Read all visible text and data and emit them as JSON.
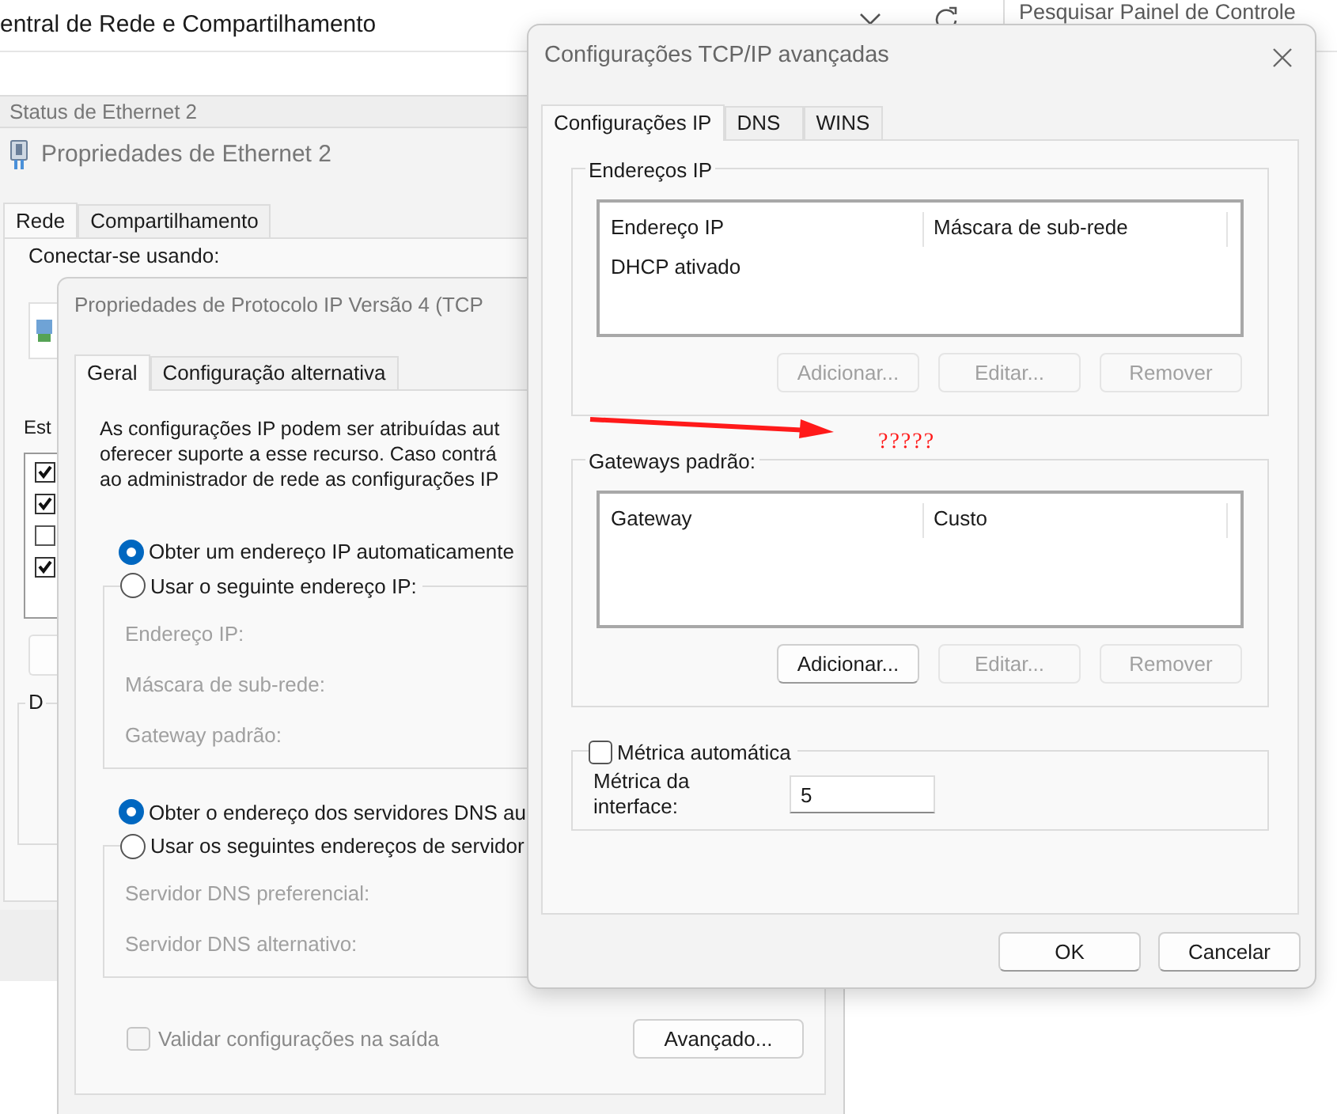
{
  "explorer": {
    "title": "entral de Rede e Compartilhamento",
    "search": {
      "placeholder": "Pesquisar Painel de Controle"
    }
  },
  "status_window": {
    "title": "Status de Ethernet 2"
  },
  "ethernet_window": {
    "title": "Propriedades de Ethernet 2",
    "tabs": [
      {
        "label": "Rede",
        "selected": true
      },
      {
        "label": "Compartilhamento",
        "selected": false
      }
    ],
    "connect_label": "Conectar-se usando:",
    "items_label": "Est",
    "components": [
      {
        "checked": true
      },
      {
        "checked": true
      },
      {
        "checked": false
      },
      {
        "checked": true
      }
    ],
    "group_label": "D"
  },
  "ipv4_window": {
    "title": "Propriedades de Protocolo IP Versão 4 (TCP",
    "tabs": [
      {
        "label": "Geral",
        "selected": true
      },
      {
        "label": "Configuração alternativa",
        "selected": false
      }
    ],
    "intro_lines": [
      "As configurações IP podem ser atribuídas aut",
      "oferecer suporte a esse recurso. Caso contrá",
      "ao administrador de rede as configurações IP"
    ],
    "ip_options": [
      {
        "label": "Obter um endereço IP automaticamente",
        "selected": true
      },
      {
        "label": "Usar o seguinte endereço IP:",
        "selected": false
      }
    ],
    "ip_fields": [
      {
        "label": "Endereço IP:",
        "disabled": true
      },
      {
        "label": "Máscara de sub-rede:",
        "disabled": true
      },
      {
        "label": "Gateway padrão:",
        "disabled": true
      }
    ],
    "dns_options": [
      {
        "label": "Obter o endereço dos servidores DNS au",
        "selected": true
      },
      {
        "label": "Usar os seguintes endereços de servidor",
        "selected": false
      }
    ],
    "dns_fields": [
      {
        "label": "Servidor DNS preferencial:",
        "disabled": true
      },
      {
        "label": "Servidor DNS alternativo:",
        "disabled": true
      }
    ],
    "validate": {
      "label": "Validar configurações na saída",
      "checked": false,
      "disabled": true
    },
    "advanced_button": "Avançado..."
  },
  "advanced_window": {
    "title": "Configurações TCP/IP avançadas",
    "tabs": [
      {
        "label": "Configurações IP",
        "selected": true
      },
      {
        "label": "DNS",
        "selected": false
      },
      {
        "label": "WINS",
        "selected": false
      }
    ],
    "ip_group": {
      "title": "Endereços IP",
      "columns": [
        "Endereço IP",
        "Máscara de sub-rede"
      ],
      "rows": [
        [
          "DHCP ativado"
        ]
      ],
      "buttons": [
        {
          "label": "Adicionar...",
          "disabled": true
        },
        {
          "label": "Editar...",
          "disabled": true
        },
        {
          "label": "Remover",
          "disabled": true
        }
      ]
    },
    "gateway_group": {
      "title": "Gateways padrão:",
      "columns": [
        "Gateway",
        "Custo"
      ],
      "buttons": [
        {
          "label": "Adicionar...",
          "disabled": false
        },
        {
          "label": "Editar...",
          "disabled": true
        },
        {
          "label": "Remover",
          "disabled": true
        }
      ]
    },
    "metric": {
      "label": "Métrica automática",
      "checked": false,
      "field_label": "Métrica da interface:",
      "value": "5"
    },
    "buttons": [
      "OK",
      "Cancelar"
    ]
  },
  "annotation": {
    "text": "?????"
  }
}
